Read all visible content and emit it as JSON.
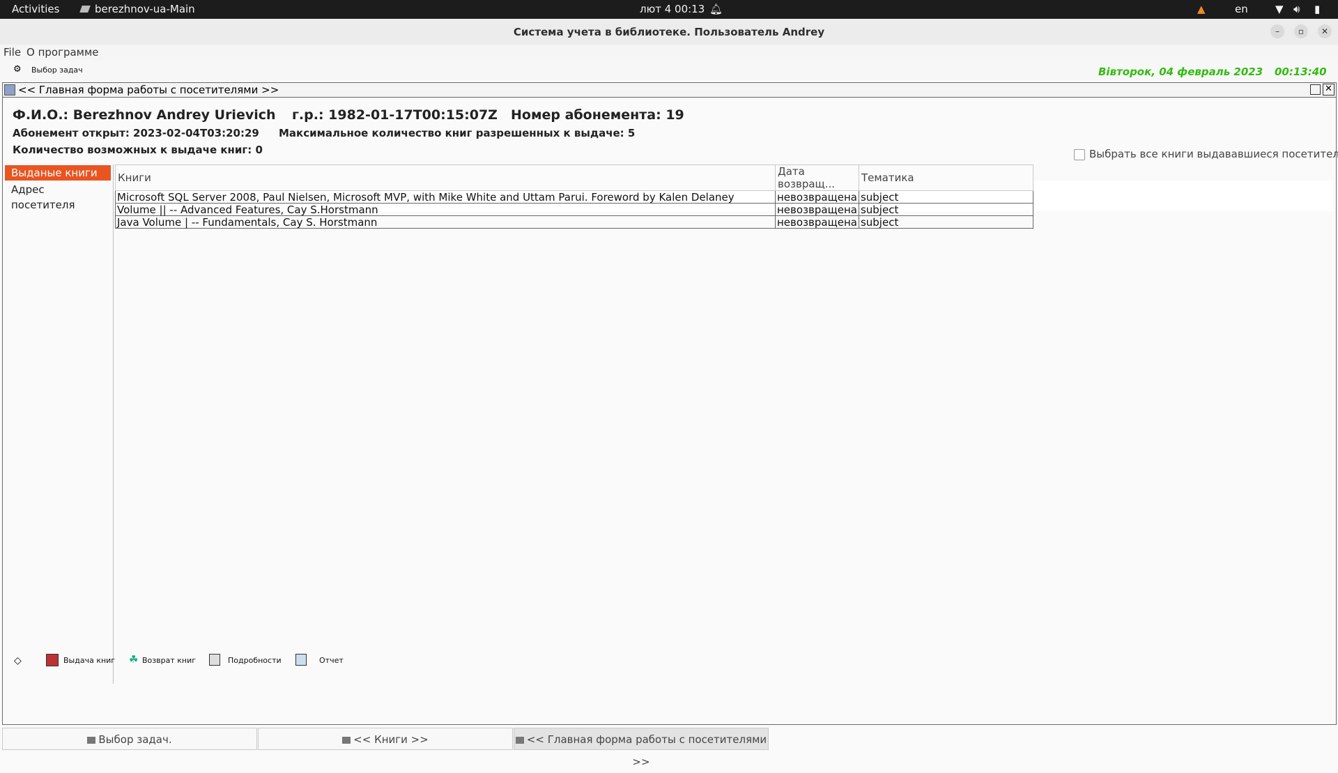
{
  "system_bar": {
    "activities": "Activities",
    "app_name": "berezhnov-ua-Main",
    "clock": "лют 4  00:13",
    "lang": "en"
  },
  "window": {
    "title": "Система учета в библиотеке. Пользователь Andrey"
  },
  "menu": {
    "file": "File",
    "about": "О программе"
  },
  "toolbar": {
    "task_select": "Выбор задач",
    "date": "Вівторок, 04 февраль 2023",
    "time": "00:13:40"
  },
  "form": {
    "title": "<< Главная форма работы с посетителями >>",
    "header": {
      "fio": "Ф.И.О.: Berezhnov   Andrey   Urievich",
      "dob": "г.р.: 1982-01-17T00:15:07Z",
      "card": "Номер абонемента: 19",
      "opened": "Абонемент открыт: 2023-02-04T03:20:29",
      "max_books": "Максимальное количество книг разрешенных к выдаче: 5",
      "available": "Количество возможных к выдаче книг: 0"
    },
    "select_all_label": "Выбрать все книги выдававшиеся посетителю.",
    "side_items": [
      "Выданые книги",
      "Адрес посетителя"
    ],
    "columns": [
      "Книги",
      "Дата возвращ...",
      "Тематика"
    ],
    "rows": [
      [
        "Microsoft SQL Server 2008, Paul Nielsen, Microsoft MVP, with Mike White and Uttam Parui. Foreword by Kalen Delaney",
        "невозвращена",
        "subject"
      ],
      [
        "Volume || -- Advanced Features, Cay S.Horstmann",
        "невозвращена",
        "subject"
      ],
      [
        "Java Volume | -- Fundamentals, Cay S. Horstmann",
        "невозвращена",
        "subject"
      ]
    ],
    "actions": {
      "issue": "Выдача книг",
      "return": "Возврат книг",
      "details": "Подробности",
      "report": "Отчет"
    }
  },
  "taskbar_tabs": [
    "Выбор задач.",
    "<< Книги >>",
    "<< Главная форма работы с посетителями >>"
  ],
  "colors": {
    "accent": "#e95420",
    "date_green": "#33bb11",
    "topbar": "#1c1c1c"
  }
}
